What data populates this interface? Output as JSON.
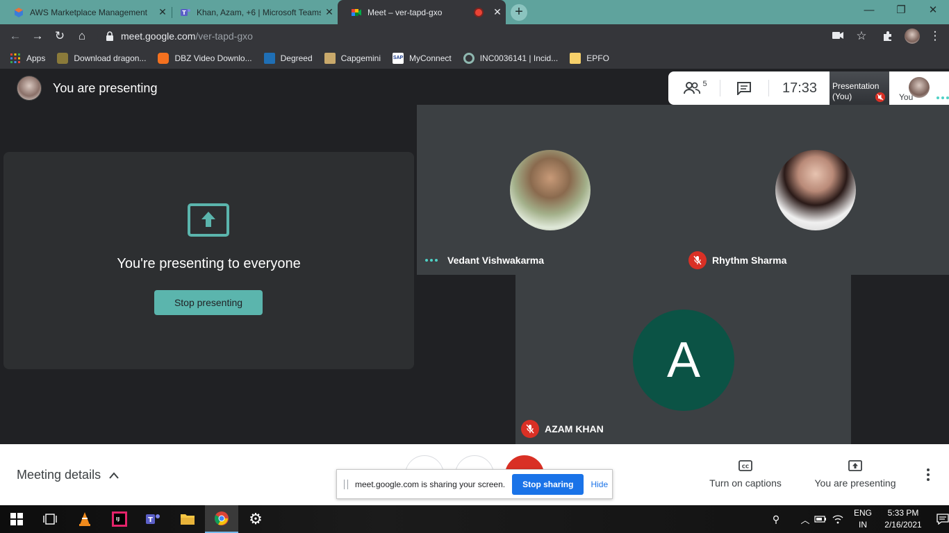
{
  "browser": {
    "tabs": [
      {
        "title": "AWS Marketplace Management",
        "active": false
      },
      {
        "title": "Khan, Azam, +6 | Microsoft Teams",
        "active": false
      },
      {
        "title": "Meet – ver-tapd-gxo",
        "active": true
      }
    ],
    "url_host": "meet.google.com",
    "url_path": "/ver-tapd-gxo",
    "bookmarks": [
      "Apps",
      "Download dragon...",
      "DBZ Video Downlo...",
      "Degreed",
      "Capgemini",
      "MyConnect",
      "INC0036141 | Incid...",
      "EPFO"
    ]
  },
  "meet": {
    "header_text": "You are presenting",
    "participants_count": "5",
    "clock": "17:33",
    "presentation_thumb_label": "Presentation (You)",
    "you_label": "You",
    "presenting_message": "You're presenting to everyone",
    "stop_presenting_label": "Stop presenting",
    "participants": [
      {
        "name": "Vedant Vishwakarma",
        "muted": false
      },
      {
        "name": "Rhythm Sharma",
        "muted": true
      },
      {
        "name": "AZAM KHAN",
        "muted": true,
        "initial": "A"
      }
    ]
  },
  "bottombar": {
    "meeting_details": "Meeting details",
    "captions_label": "Turn on captions",
    "presenting_label": "You are presenting"
  },
  "share_notice": {
    "text": "meet.google.com is sharing your screen.",
    "stop_label": "Stop sharing",
    "hide_label": "Hide"
  },
  "taskbar": {
    "lang_line1": "ENG",
    "lang_line2": "IN",
    "time": "5:33 PM",
    "date": "2/16/2021"
  },
  "colors": {
    "meet_accent": "#5bb5ad",
    "mute_red": "#d93025",
    "share_blue": "#1a73e8",
    "azam_avatar": "#0b5345"
  }
}
